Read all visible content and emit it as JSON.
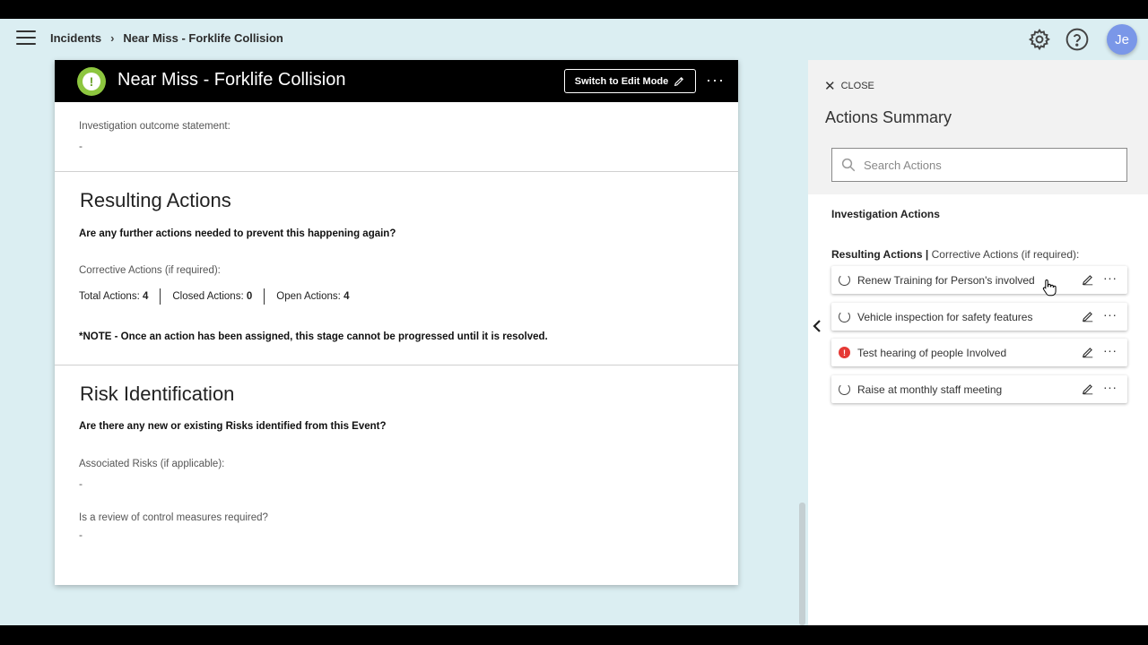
{
  "breadcrumb": {
    "root": "Incidents",
    "current": "Near Miss - Forklife Collision"
  },
  "user": {
    "initials": "Je"
  },
  "icons": {
    "menu": "hamburger-icon",
    "settings": "gear-icon",
    "help": "help-icon",
    "alert": "exclamation-icon",
    "edit": "pencil-icon",
    "more": "more-icon",
    "close": "close-icon",
    "search": "search-icon",
    "collapse": "chevron-left-icon",
    "in_progress": "spinner-icon",
    "overdue": "warning-icon"
  },
  "colors": {
    "app_bg": "#dbeef2",
    "header_bg": "#000000",
    "alert_badge": "#8dc63f",
    "avatar_bg": "#7a97e8",
    "warning": "#e53935"
  },
  "card": {
    "title": "Near Miss - Forklife Collision",
    "edit_mode_label": "Switch to Edit Mode",
    "more_label": "···",
    "outcome": {
      "label": "Investigation outcome statement:",
      "value": "-"
    },
    "resulting_actions": {
      "title": "Resulting Actions",
      "question": "Are any further actions needed to prevent this happening again?",
      "corrective_label": "Corrective Actions (if required):",
      "total_label": "Total Actions:",
      "total_value": "4",
      "closed_label": "Closed Actions:",
      "closed_value": "0",
      "open_label": "Open Actions:",
      "open_value": "4",
      "note": "*NOTE - Once an action has been assigned, this stage cannot be progressed until it is resolved."
    },
    "risk": {
      "title": "Risk Identification",
      "question": "Are there any new or existing Risks identified from this Event?",
      "associated_label": "Associated Risks (if applicable):",
      "associated_value": "-",
      "review_label": "Is a review of control measures required?",
      "review_value": "-"
    }
  },
  "panel": {
    "close_label": "CLOSE",
    "title": "Actions Summary",
    "search_placeholder": "Search Actions",
    "investigation_heading": "Investigation Actions",
    "resulting_heading": "Resulting Actions",
    "resulting_sep": "|",
    "resulting_sub": "Corrective Actions (if required):",
    "actions": [
      {
        "label": "Renew Training for Person's involved",
        "status": "in-progress"
      },
      {
        "label": "Vehicle inspection for safety features",
        "status": "in-progress"
      },
      {
        "label": "Test hearing of people Involved",
        "status": "overdue"
      },
      {
        "label": "Raise at monthly staff meeting",
        "status": "in-progress"
      }
    ]
  }
}
